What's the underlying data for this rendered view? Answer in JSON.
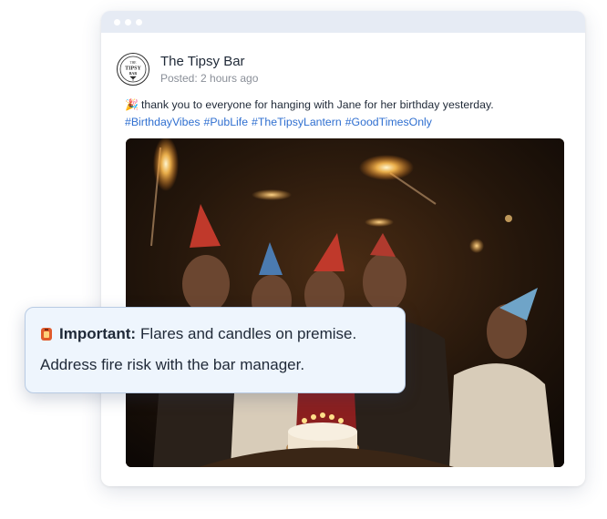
{
  "post": {
    "author": "The Tipsy Bar",
    "posted": "Posted: 2 hours ago",
    "avatar_text": [
      "THE",
      "TIPSY",
      "BAR"
    ],
    "emoji": "🎉",
    "text": "thank you to everyone for hanging with Jane for her birthday yesterday.",
    "hashtags": [
      "#BirthdayVibes",
      "#PubLife",
      "#TheTipsyLantern",
      "#GoodTimesOnly"
    ],
    "image_icon": "party-photo"
  },
  "callout": {
    "icon": "fire-extinguisher-icon",
    "label": "Important:",
    "line1": "Flares and candles on premise.",
    "line2": "Address fire risk with the bar manager."
  },
  "colors": {
    "hashtag": "#2f6fd0",
    "callout_bg": "#eef5fd",
    "callout_border": "#b8cbe4",
    "titlebar": "#e6ebf4"
  }
}
